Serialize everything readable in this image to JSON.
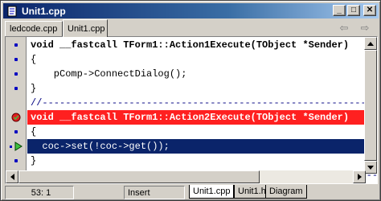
{
  "window": {
    "title": "Unit1.cpp",
    "minimize": "_",
    "maximize": "□",
    "close": "✕"
  },
  "tabs": [
    {
      "label": "ledcode.cpp"
    },
    {
      "label": "Unit1.cpp"
    }
  ],
  "nav": {
    "back": "⇦",
    "forward": "⇨"
  },
  "code": {
    "lines": [
      {
        "text": "void __fastcall TForm1::Action1Execute(TObject *Sender)"
      },
      {
        "text": "{"
      },
      {
        "text": "    pComp->ConnectDialog();"
      },
      {
        "text": "}"
      },
      {
        "text": "//-----------------------------------------------------------"
      },
      {
        "text": "void __fastcall TForm1::Action2Execute(TObject *Sender)"
      },
      {
        "text": "{"
      },
      {
        "text": "  coc->set(!coc->get());"
      },
      {
        "text": "}"
      },
      {
        "text": "//-----------------------------------------------------------"
      }
    ]
  },
  "status": {
    "position": "53:  1",
    "mode": "Insert"
  },
  "bottom_tabs": [
    {
      "label": "Unit1.cpp"
    },
    {
      "label": "Unit1.h"
    },
    {
      "label": "Diagram"
    }
  ],
  "colors": {
    "title_start": "#0a246a",
    "error_line": "#ff2020",
    "exec_line": "#0a246a"
  }
}
